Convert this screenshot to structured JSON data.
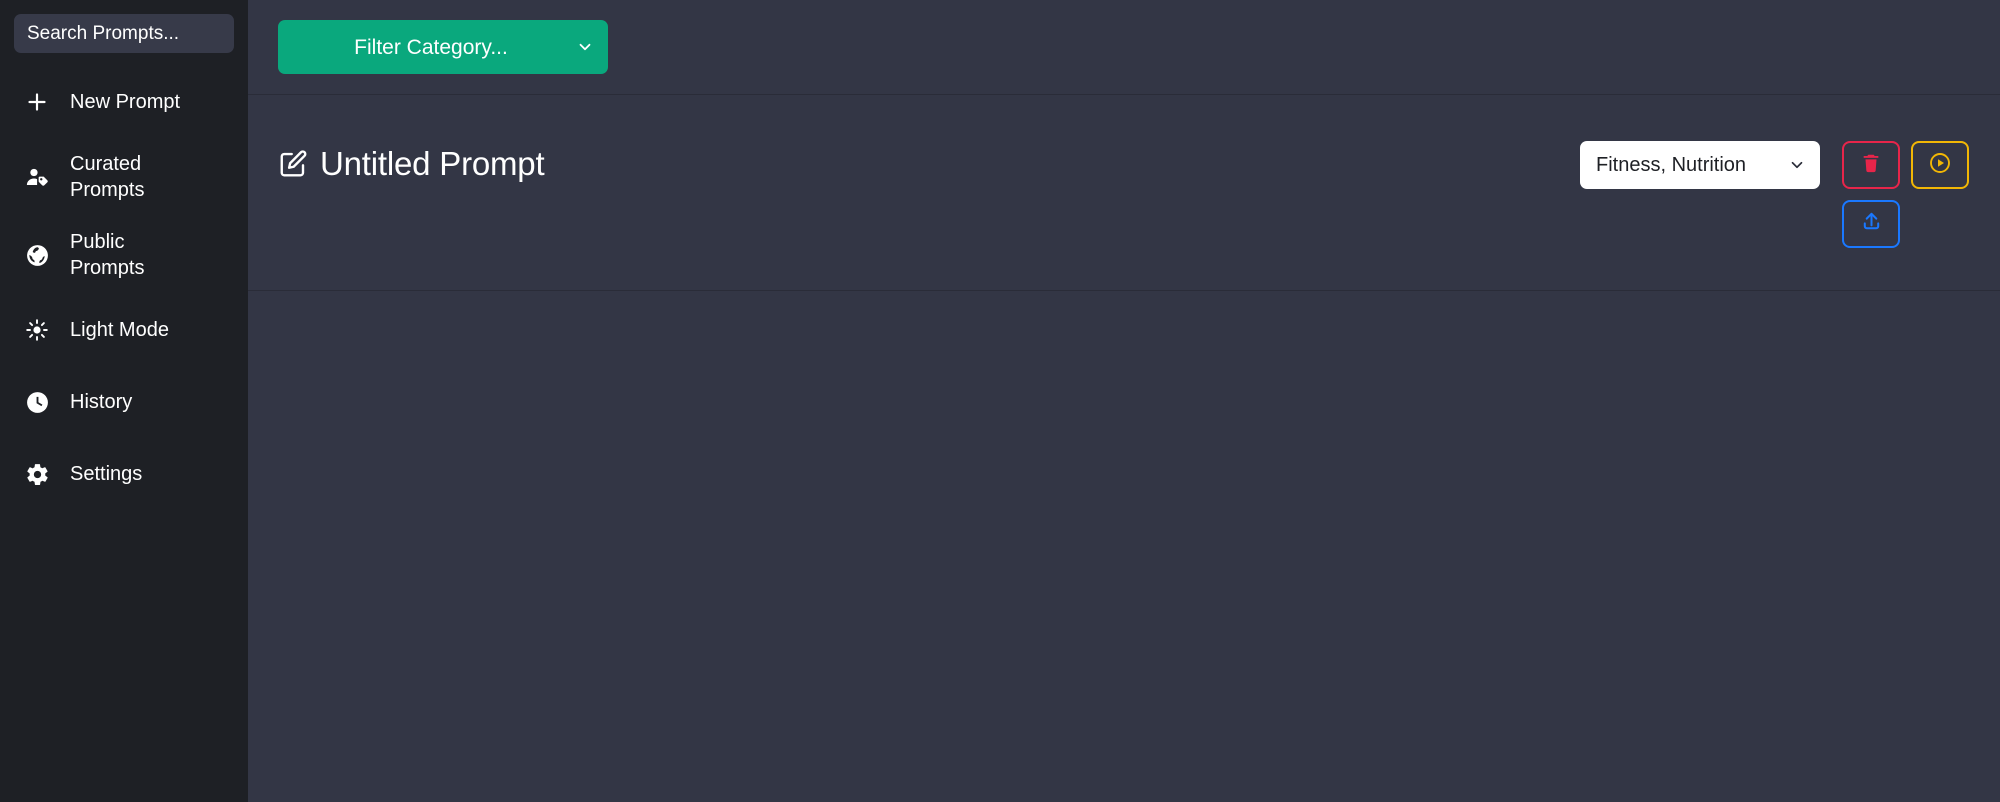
{
  "sidebar": {
    "search": {
      "placeholder": "Search Prompts...",
      "value": ""
    },
    "items": [
      {
        "label": "New Prompt",
        "icon": "plus-icon"
      },
      {
        "label": "Curated Prompts",
        "icon": "user-tag-icon"
      },
      {
        "label": "Public Prompts",
        "icon": "globe-icon"
      },
      {
        "label": "Light Mode",
        "icon": "sun-icon"
      },
      {
        "label": "History",
        "icon": "clock-icon"
      },
      {
        "label": "Settings",
        "icon": "gear-icon"
      }
    ]
  },
  "topbar": {
    "filter": {
      "selected": "Filter Category...",
      "options": [
        "Filter Category..."
      ],
      "icon": "chevron-down-icon"
    }
  },
  "prompt": {
    "title": "Untitled Prompt",
    "title_icon": "edit-square-icon",
    "category": {
      "selected": "Fitness, Nutrition",
      "options": [
        "Fitness, Nutrition"
      ],
      "icon": "chevron-down-icon"
    },
    "actions": [
      {
        "name": "delete-prompt-button",
        "icon": "trash-icon",
        "color": "#e8254a"
      },
      {
        "name": "run-prompt-button",
        "icon": "play-circle-icon",
        "color": "#f2b705"
      },
      {
        "name": "upload-prompt-button",
        "icon": "upload-icon",
        "color": "#1a78ff"
      }
    ]
  },
  "colors": {
    "sidebar_bg": "#1e2025",
    "main_bg": "#333645",
    "search_bg": "#373a49",
    "accent_green": "#0aa87d",
    "divider": "#2a2c38",
    "danger": "#e8254a",
    "warning": "#f2b705",
    "info": "#1a78ff"
  }
}
